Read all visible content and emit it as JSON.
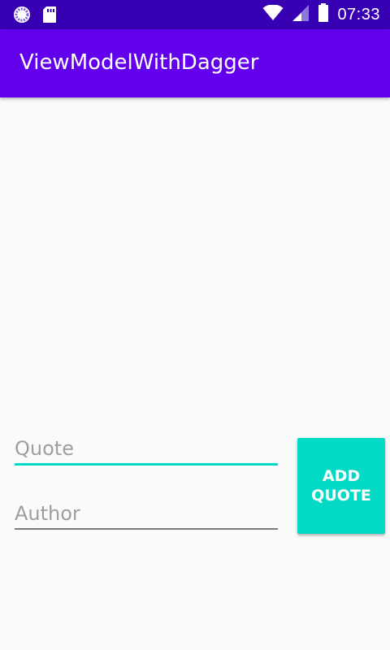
{
  "status_bar": {
    "time": "07:33",
    "icons": [
      "loading-icon",
      "sd-card-icon",
      "wifi-icon",
      "cell-signal-icon",
      "battery-icon"
    ]
  },
  "app_bar": {
    "title": "ViewModelWithDagger",
    "color": "#6200ee"
  },
  "form": {
    "quote_placeholder": "Quote",
    "quote_value": "",
    "author_placeholder": "Author",
    "author_value": "",
    "add_button_label": "ADD QUOTE"
  },
  "colors": {
    "primary": "#6200ee",
    "primary_dark": "#3700b3",
    "accent": "#03dac5",
    "background": "#fafafa"
  }
}
